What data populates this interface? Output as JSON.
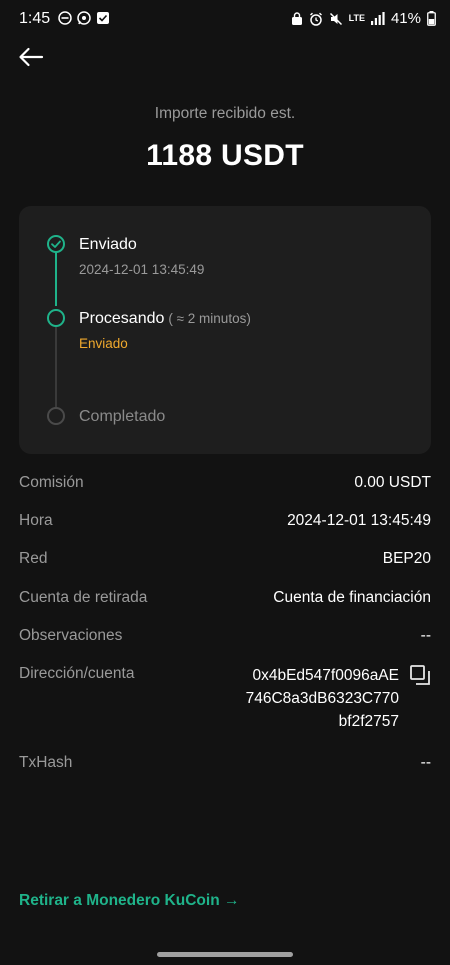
{
  "status_bar": {
    "time": "1:45",
    "battery": "41%",
    "network": "LTE"
  },
  "header": {
    "caption": "Importe recibido est.",
    "amount": "1188 USDT"
  },
  "progress": {
    "steps": [
      {
        "title": "Enviado",
        "subtitle": "2024-12-01 13:45:49"
      },
      {
        "title": "Procesando",
        "note": "( ≈ 2 minutos)",
        "status": "Enviado"
      },
      {
        "title": "Completado"
      }
    ]
  },
  "details": {
    "commission": {
      "label": "Comisión",
      "value": "0.00 USDT"
    },
    "time": {
      "label": "Hora",
      "value": "2024-12-01 13:45:49"
    },
    "network": {
      "label": "Red",
      "value": "BEP20"
    },
    "account": {
      "label": "Cuenta de retirada",
      "value": "Cuenta de financiación"
    },
    "remarks": {
      "label": "Observaciones",
      "value": "--"
    },
    "address": {
      "label": "Dirección/cuenta",
      "lines": [
        "0x4bEd547f0096aAE",
        "746C8a3dB6323C770",
        "bf2f2757"
      ]
    },
    "txhash": {
      "label": "TxHash",
      "value": "--"
    }
  },
  "footer": {
    "withdraw_link": "Retirar a Monedero KuCoin →"
  },
  "colors": {
    "background": "#121212",
    "card": "#1e1e1e",
    "accent_green": "#1fb38a",
    "status_orange": "#f0a92d",
    "muted_text": "#9a9a9a"
  }
}
